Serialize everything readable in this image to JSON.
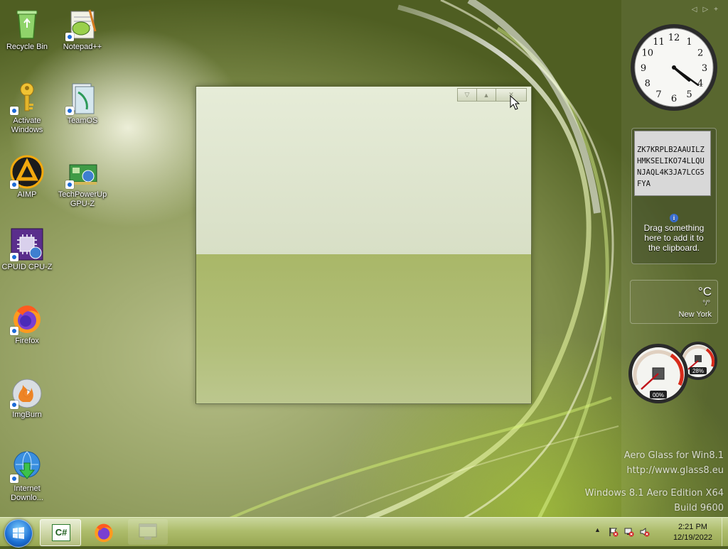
{
  "desktop_icons": [
    {
      "name": "recycle-bin",
      "label": "Recycle Bin"
    },
    {
      "name": "notepad-plus-plus",
      "label": "Notepad++"
    },
    {
      "name": "activate-windows",
      "label": "Activate Windows"
    },
    {
      "name": "teamos",
      "label": "TeamOS"
    },
    {
      "name": "aimp",
      "label": "AIMP"
    },
    {
      "name": "techpowerup-gpu-z",
      "label": "TechPowerUp GPU-Z"
    },
    {
      "name": "cpuid-cpu-z",
      "label": "CPUID CPU-Z"
    },
    {
      "name": "firefox",
      "label": "Firefox"
    },
    {
      "name": "imgburn",
      "label": "ImgBurn"
    },
    {
      "name": "internet-download",
      "label": "Internet Downlo..."
    }
  ],
  "gadgets": {
    "clock": {
      "hour": 4,
      "minute": 21,
      "numbers": [
        "12",
        "1",
        "2",
        "3",
        "4",
        "5",
        "6",
        "7",
        "8",
        "9",
        "10",
        "11"
      ]
    },
    "clipboard": {
      "content": "ZK7KRPLB2AAUILZHMKSELIKO74LLQUNJAQL4K3JA7LCG5FYA",
      "hint": "Drag something here to add it to the clipboard."
    },
    "weather": {
      "unit": "°C",
      "value": "°/°",
      "city": "New York"
    },
    "meter": {
      "cpu": "00%",
      "memory": "28%",
      "cpu_fraction": 0.0,
      "memory_fraction": 0.28
    }
  },
  "watermark": {
    "line1": "Aero Glass for Win8.1",
    "line2": "http://www.glass8.eu",
    "line3": "Windows 8.1 Aero Edition X64",
    "line4": "Build 9600"
  },
  "taskbar": {
    "items": [
      {
        "name": "csharp-app",
        "label": "C#"
      },
      {
        "name": "firefox"
      },
      {
        "name": "window-app"
      }
    ],
    "tray": {
      "time": "2:21 PM",
      "date": "12/19/2022",
      "show_hidden_icon": "▲"
    }
  },
  "colors": {
    "accent": "#9aaa55",
    "taskbar": "#aebd6c",
    "start": "#1c6fd3"
  }
}
